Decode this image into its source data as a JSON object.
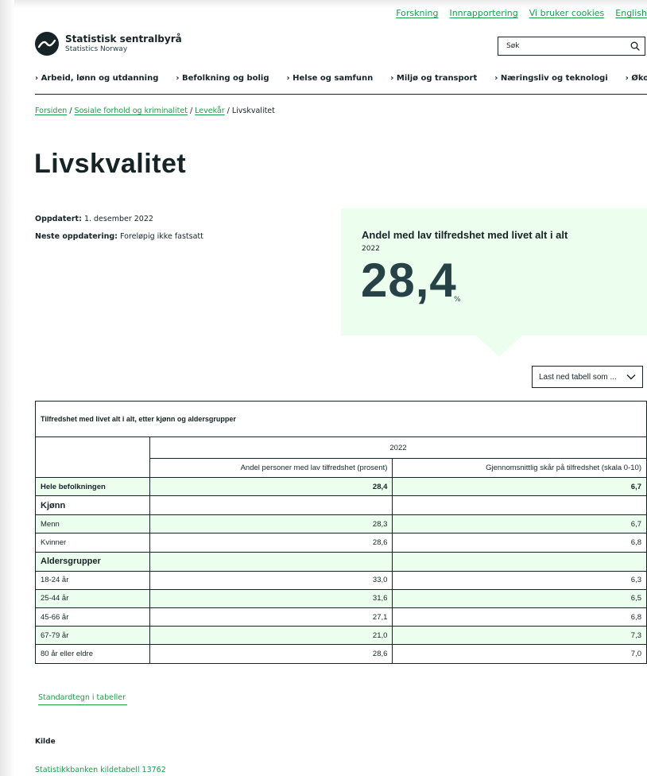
{
  "top_links": [
    "Forskning",
    "Innrapportering",
    "Vi bruker cookies",
    "English"
  ],
  "logo": {
    "name": "Statistisk sentralbyrå",
    "subtitle": "Statistics Norway"
  },
  "search": {
    "placeholder": "Søk"
  },
  "main_nav": [
    "› Arbeid, lønn og utdanning",
    "› Befolkning og bolig",
    "› Helse og samfunn",
    "› Miljø og transport",
    "› Næringsliv og teknologi",
    "› Økonomi"
  ],
  "breadcrumb": {
    "items": [
      "Forsiden",
      "Sosiale forhold og kriminalitet",
      "Levekår"
    ],
    "current": "Livskvalitet",
    "separator": "/"
  },
  "page_title": "Livskvalitet",
  "meta": {
    "updated_label": "Oppdatert:",
    "updated_value": "1. desember 2022",
    "next_label": "Neste oppdatering:",
    "next_value": "Foreløpig ikke fastsatt"
  },
  "highlight": {
    "title": "Andel med lav tilfredshet med livet alt i alt",
    "year": "2022",
    "value": "28,4",
    "unit": "%"
  },
  "download": {
    "label": "Last ned tabell som ..."
  },
  "table": {
    "caption": "Tilfredshet med livet alt i alt, etter kjønn og aldersgrupper",
    "year": "2022",
    "col1": "Andel personer med lav tilfredshet (prosent)",
    "col2": "Gjennomsnittlig skår på tilfredshet (skala 0-10)",
    "rows": [
      {
        "label": "Hele befolkningen",
        "v1": "28,4",
        "v2": "6,7"
      },
      {
        "label": "Kjønn",
        "v1": "",
        "v2": ""
      },
      {
        "label": "Menn",
        "v1": "28,3",
        "v2": "6,7"
      },
      {
        "label": "Kvinner",
        "v1": "28,6",
        "v2": "6,8"
      },
      {
        "label": "Aldersgrupper",
        "v1": "",
        "v2": ""
      },
      {
        "label": "18-24 år",
        "v1": "33,0",
        "v2": "6,3"
      },
      {
        "label": "25-44 år",
        "v1": "31,6",
        "v2": "6,5"
      },
      {
        "label": "45-66 år",
        "v1": "27,1",
        "v2": "6,8"
      },
      {
        "label": "67-79 år",
        "v1": "21,0",
        "v2": "7,3"
      },
      {
        "label": "80 år eller eldre",
        "v1": "28,6",
        "v2": "7,0"
      }
    ]
  },
  "standard_link": "Standardtegn i tabeller",
  "source": {
    "heading": "Kilde",
    "link": "Statistikkbanken kildetabell 13762"
  },
  "colors": {
    "accent_green": "#1a9d49",
    "highlight_bg": "#ecfeed",
    "text_dark": "#162327"
  }
}
